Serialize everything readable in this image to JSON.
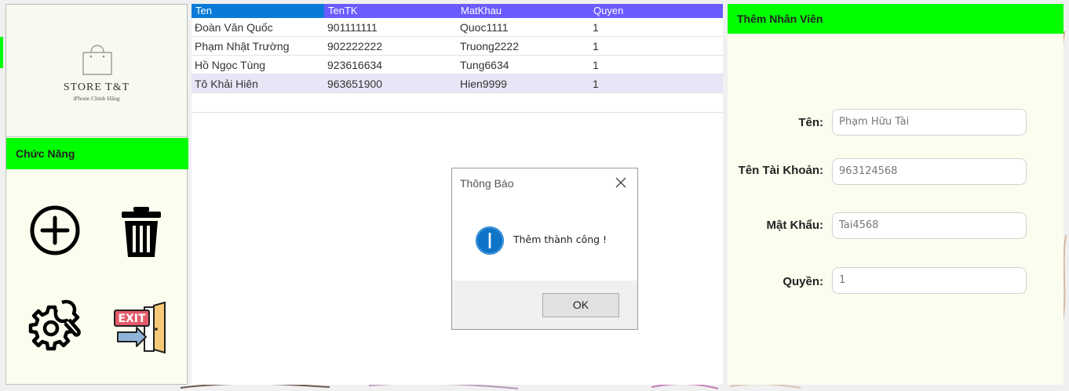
{
  "store": {
    "title": "STORE T&T",
    "subtitle": "iPhone Chính Hãng"
  },
  "function_panel": {
    "header": "Chức Năng",
    "buttons": [
      {
        "icon": "add-circle-icon"
      },
      {
        "icon": "trash-icon"
      },
      {
        "icon": "settings-wrench-icon"
      },
      {
        "icon": "exit-door-icon"
      }
    ]
  },
  "grid": {
    "columns": [
      "Ten",
      "TenTK",
      "MatKhau",
      "Quyen"
    ],
    "rows": [
      [
        "Đoàn Văn Quốc",
        "901111111",
        "Quoc1111",
        "1"
      ],
      [
        "Phạm Nhật Trường",
        "902222222",
        "Truong2222",
        "1"
      ],
      [
        "Hồ Ngọc Tùng",
        "923616634",
        "Tung6634",
        "1"
      ],
      [
        "Tô Khải Hiên",
        "963651900",
        "Hien9999",
        "1"
      ]
    ],
    "selected_row": 3
  },
  "form": {
    "header": "Thêm Nhân Viên",
    "fields": [
      {
        "label": "Tên:",
        "value": "Phạm Hữu Tài"
      },
      {
        "label": "Tên Tài Khoản:",
        "value": "963124568"
      },
      {
        "label": "Mật Khẩu:",
        "value": "Tai4568"
      },
      {
        "label": "Quyền:",
        "value": "1"
      }
    ]
  },
  "dialog": {
    "title": "Thông Báo",
    "message": "Thêm thành công !",
    "ok_label": "OK",
    "icon": "info-icon"
  },
  "colors": {
    "accent_green": "#00ff00",
    "panel_bg": "#fbfdee",
    "grid_header_first": "#0a7ad8",
    "grid_header_rest": "#6a5cff",
    "selected_row": "#e7e6f7",
    "info_blue": "#0f73c8"
  }
}
